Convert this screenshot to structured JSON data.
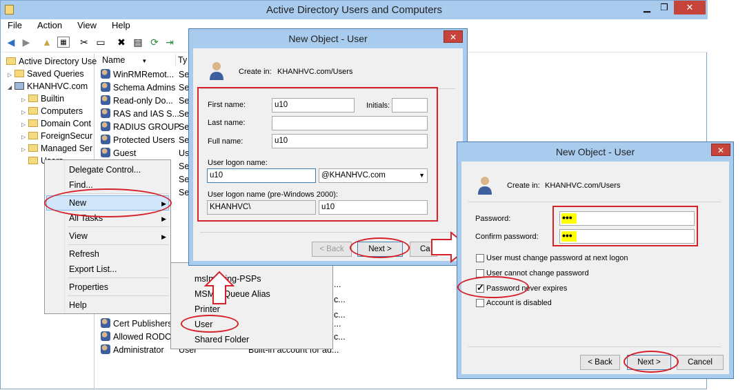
{
  "window": {
    "title": "Active Directory Users and Computers",
    "minimize": "▁",
    "restore": "❐",
    "close": "✕"
  },
  "menu": {
    "file": "File",
    "action": "Action",
    "view": "View",
    "help": "Help"
  },
  "tree": {
    "root": "Active Directory Use",
    "saved_queries": "Saved Queries",
    "domain": "KHANHVC.com",
    "children": [
      "Builtin",
      "Computers",
      "Domain Cont",
      "ForeignSecur",
      "Managed Ser",
      "Users"
    ]
  },
  "list": {
    "col_name": "Name",
    "col_type": "Ty",
    "rows_top": [
      {
        "name": "WinRMRemot...",
        "type": "Se"
      },
      {
        "name": "Schema Admins",
        "type": "Se"
      },
      {
        "name": "Read-only Do...",
        "type": "Se"
      },
      {
        "name": "RAS and IAS S...",
        "type": "Se"
      },
      {
        "name": "RADIUS GROUP",
        "type": "Se"
      },
      {
        "name": "Protected Users",
        "type": "Se"
      },
      {
        "name": "Guest",
        "type": "Us"
      },
      {
        "name": "",
        "type": "Se"
      },
      {
        "name": "",
        "type": "Se"
      },
      {
        "name": "",
        "type": "Se"
      }
    ],
    "rows_bottom": [
      {
        "name": "Cert Publishers",
        "type": "",
        "desc": "..."
      },
      {
        "name": "Allowed RODC...",
        "type": "",
        "desc": "c..."
      },
      {
        "name": "Administrator",
        "type": "User",
        "desc": "Built-in account for ad..."
      }
    ],
    "desc_fragments": [
      "...",
      "c...",
      "c...",
      "..."
    ]
  },
  "context_menu": {
    "delegate": "Delegate Control...",
    "find": "Find...",
    "new": "New",
    "all_tasks": "All Tasks",
    "view": "View",
    "refresh": "Refresh",
    "export": "Export List...",
    "properties": "Properties",
    "help": "Help"
  },
  "submenu": {
    "items": [
      "msImaging-PSPs",
      "MSMQ Queue Alias",
      "Printer",
      "User",
      "Shared Folder"
    ]
  },
  "dialog1": {
    "title": "New Object - User",
    "close": "✕",
    "create_in_label": "Create in:",
    "create_in_value": "KHANHVC.com/Users",
    "first_name_label": "First name:",
    "first_name_value": "u10",
    "initials_label": "Initials:",
    "initials_value": "",
    "last_name_label": "Last name:",
    "last_name_value": "",
    "full_name_label": "Full name:",
    "full_name_value": "u10",
    "logon_label": "User logon name:",
    "logon_value": "u10",
    "domain_suffix": "@KHANHVC.com",
    "logon_pre2000_label": "User logon name (pre-Windows 2000):",
    "pre2000_domain": "KHANHVC\\",
    "pre2000_value": "u10",
    "back": "< Back",
    "next": "Next >",
    "cancel": "Ca"
  },
  "dialog2": {
    "title": "New Object - User",
    "close": "✕",
    "create_in_label": "Create in:",
    "create_in_value": "KHANHVC.com/Users",
    "password_label": "Password:",
    "password_value": "•••",
    "confirm_label": "Confirm password:",
    "confirm_value": "•••",
    "opt_must_change": "User must change password at next logon",
    "opt_cannot_change": "User cannot change password",
    "opt_never_expires": "Password never expires",
    "opt_disabled": "Account is disabled",
    "back": "< Back",
    "next": "Next >",
    "cancel": "Cancel",
    "checked": [
      false,
      false,
      true,
      false
    ]
  },
  "colors": {
    "annotation": "#d6202a",
    "titlebar": "#a9cbee",
    "highlight": "#ffff00"
  }
}
